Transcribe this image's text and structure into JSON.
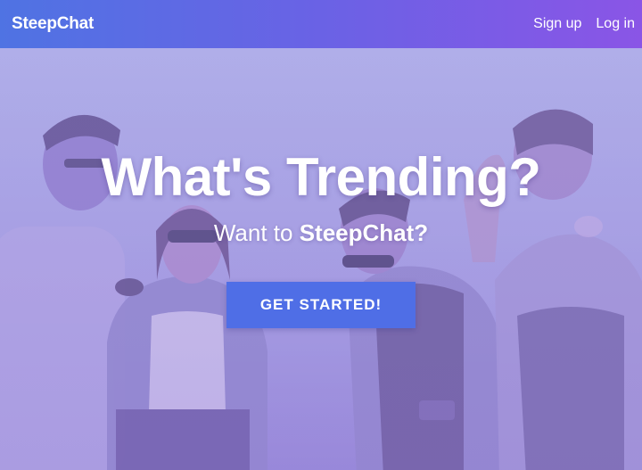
{
  "navbar": {
    "brand": "SteepChat",
    "links": [
      {
        "label": "Sign up"
      },
      {
        "label": "Log in"
      }
    ]
  },
  "hero": {
    "title": "What's Trending?",
    "subtitle_prefix": "Want to ",
    "subtitle_brand": "SteepChat?",
    "cta_label": "GET STARTED!",
    "image": "group-of-friends-photo"
  },
  "colors": {
    "navbar_start": "#4f73e3",
    "navbar_end": "#8a55e6",
    "cta": "#4f6ee6",
    "text": "#ffffff"
  }
}
